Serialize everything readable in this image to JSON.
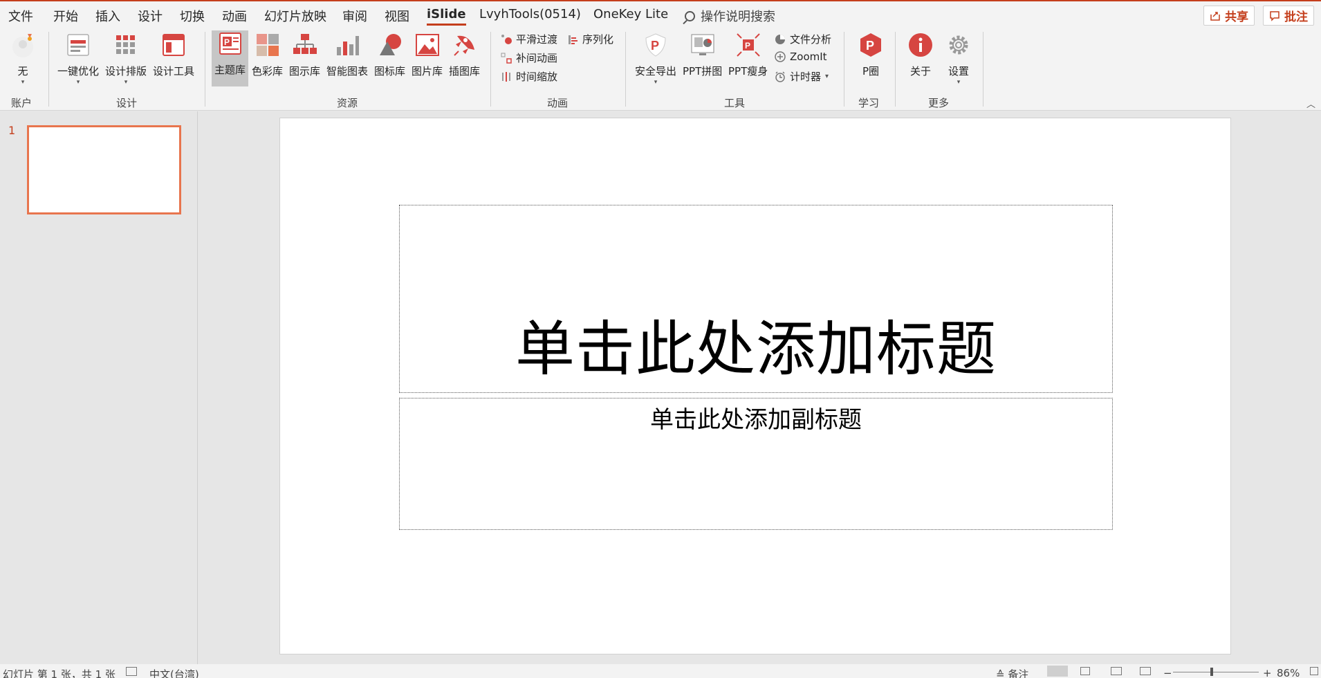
{
  "tabs": [
    "文件",
    "开始",
    "插入",
    "设计",
    "切换",
    "动画",
    "幻灯片放映",
    "审阅",
    "视图",
    "iSlide",
    "LvyhTools(0514)",
    "OneKey Lite"
  ],
  "active_tab": "iSlide",
  "search": {
    "label": "操作说明搜索"
  },
  "share_button": "共享",
  "comment_button": "批注",
  "ribbon": {
    "account": {
      "button": "无",
      "group": "账户"
    },
    "design": {
      "buttons": [
        "一键优化",
        "设计排版",
        "设计工具"
      ],
      "group": "设计"
    },
    "resources": {
      "buttons": [
        "主题库",
        "色彩库",
        "图示库",
        "智能图表",
        "图标库",
        "图片库",
        "插图库"
      ],
      "group": "资源"
    },
    "animation": {
      "buttons": [
        "平滑过渡",
        "序列化",
        "补间动画",
        "时间缩放"
      ],
      "group": "动画"
    },
    "tools": {
      "buttons": [
        "安全导出",
        "PPT拼图",
        "PPT瘦身",
        "文件分析",
        "ZoomIt",
        "计时器"
      ],
      "group": "工具"
    },
    "learn": {
      "button": "P圈",
      "group": "学习"
    },
    "more": {
      "buttons": [
        "关于",
        "设置"
      ],
      "group": "更多"
    }
  },
  "thumbnails": {
    "slide_number": "1"
  },
  "slide": {
    "title_placeholder": "单击此处添加标题",
    "subtitle_placeholder": "单击此处添加副标题"
  },
  "status": {
    "slide_info": "幻灯片 第 1 张，共 1 张",
    "language": "中文(台湾)",
    "notes": "备注",
    "zoom": "86%"
  },
  "colors": {
    "accent": "#c43e1c",
    "thumb_border": "#e8754e",
    "icon_red": "#d64541"
  }
}
